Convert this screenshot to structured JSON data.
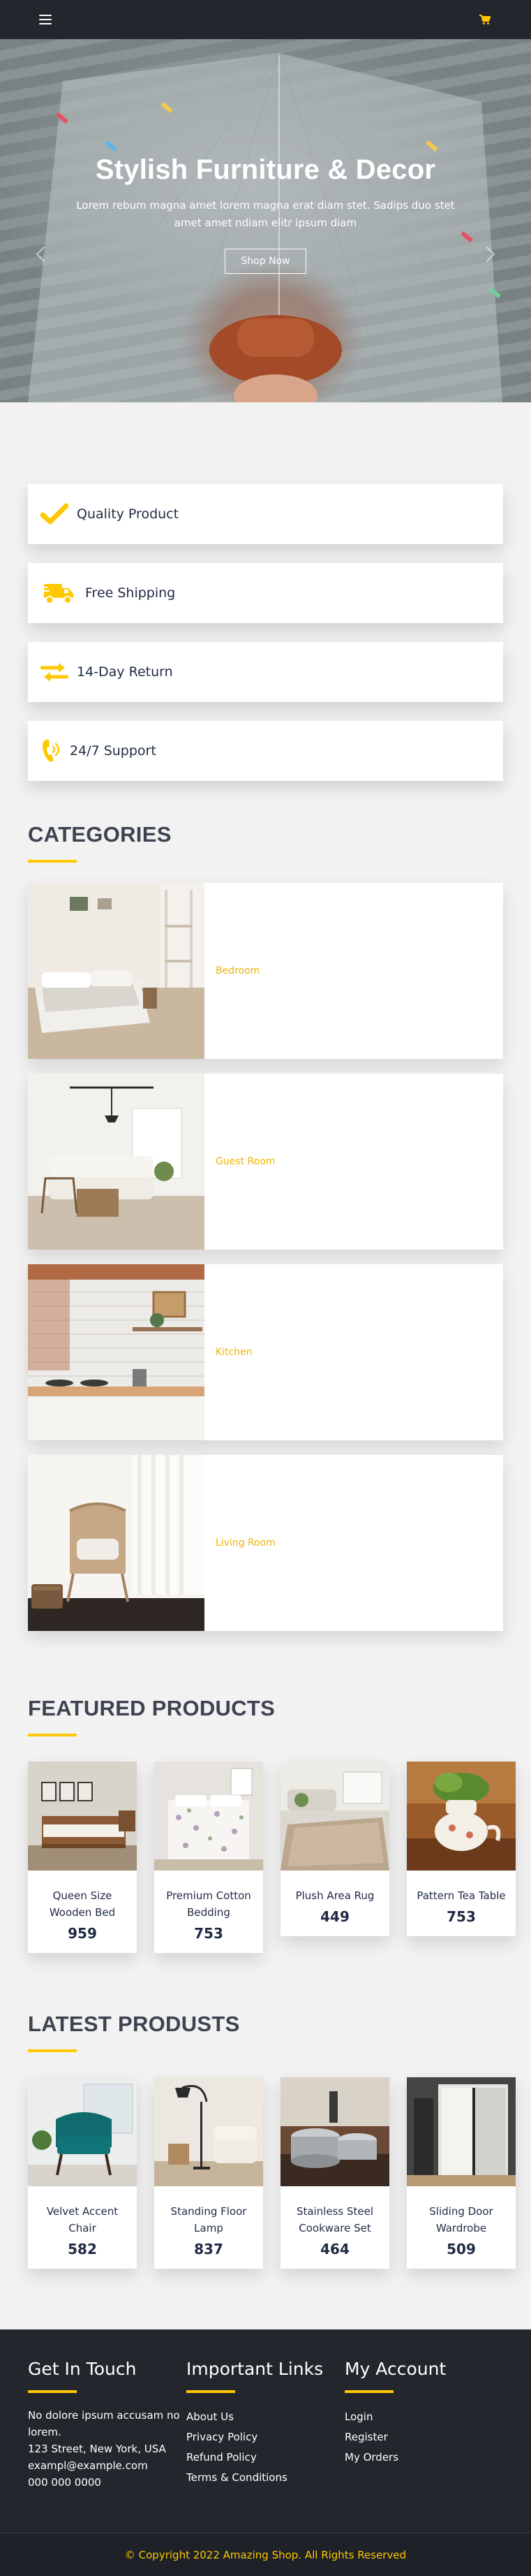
{
  "header": {
    "menu_icon": "hamburger-menu-icon",
    "cart_icon": "shopping-cart-icon",
    "accent": "#ffc800",
    "background": "#23262d"
  },
  "hero": {
    "title": "Stylish Furniture & Decor",
    "subtitle": "Lorem rebum magna amet lorem magna erat diam stet. Sadips duo stet amet amet ndiam elitr ipsum diam",
    "button_label": "Shop Now"
  },
  "features": [
    {
      "icon": "check-icon",
      "label": "Quality Product"
    },
    {
      "icon": "shipping-truck-icon",
      "label": "Free Shipping"
    },
    {
      "icon": "exchange-arrows-icon",
      "label": "14-Day Return"
    },
    {
      "icon": "phone-volume-icon",
      "label": "24/7 Support"
    }
  ],
  "categories": {
    "title": "CATEGORIES",
    "items": [
      {
        "name": "Bedroom"
      },
      {
        "name": "Guest Room"
      },
      {
        "name": "Kitchen"
      },
      {
        "name": "Living Room"
      }
    ]
  },
  "featured": {
    "title": "FEATURED PRODUCTS",
    "items": [
      {
        "name": "Queen Size Wooden Bed",
        "price": "959"
      },
      {
        "name": "Premium Cotton Bedding",
        "price": "753"
      },
      {
        "name": "Plush Area Rug",
        "price": "449"
      },
      {
        "name": "Pattern Tea Table",
        "price": "753"
      }
    ]
  },
  "latest": {
    "title": "LATEST PRODUSTS",
    "items": [
      {
        "name": "Velvet Accent Chair",
        "price": "582"
      },
      {
        "name": "Standing Floor Lamp",
        "price": "837"
      },
      {
        "name": "Stainless Steel Cookware Set",
        "price": "464"
      },
      {
        "name": "Sliding Door Wardrobe",
        "price": "509"
      }
    ]
  },
  "footer": {
    "contact": {
      "title": "Get In Touch",
      "lines": [
        "No dolore ipsum accusam no lorem.",
        "123 Street, New York, USA",
        "exampl@example.com",
        "000 000 0000"
      ]
    },
    "links": {
      "title": "Important Links",
      "items": [
        "About Us",
        "Privacy Policy",
        "Refund Policy",
        "Terms & Conditions"
      ]
    },
    "account": {
      "title": "My Account",
      "items": [
        "Login",
        "Register",
        "My Orders"
      ]
    },
    "copyright": "© Copyright 2022 Amazing Shop. All Rights Reserved"
  }
}
